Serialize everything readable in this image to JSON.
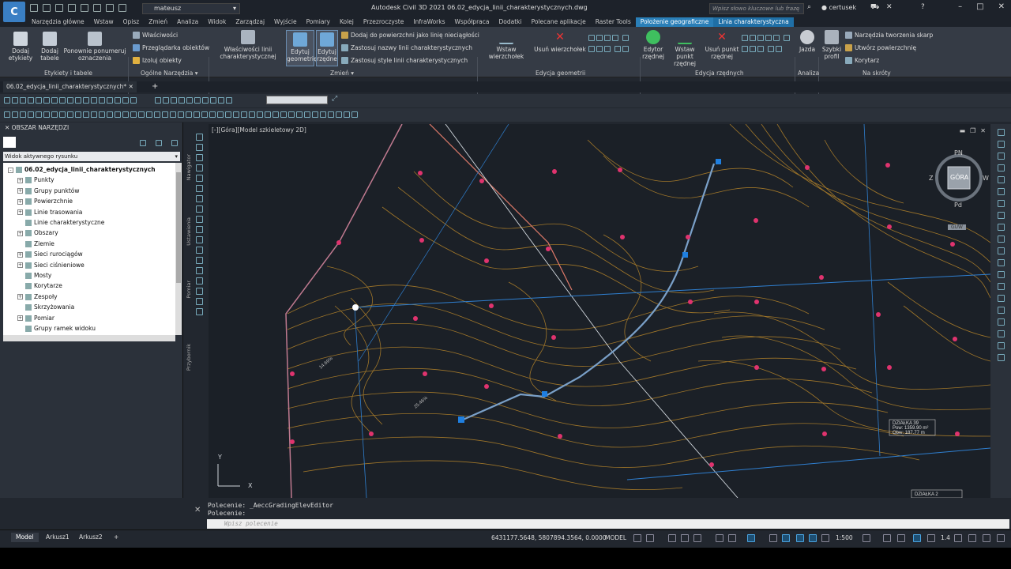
{
  "app": {
    "logo_letter": "C",
    "workspace": "mateusz",
    "window_title": "Autodesk Civil 3D 2021   06.02_edycja_linii_charakterystycznych.dwg",
    "search_placeholder": "Wpisz słowo kluczowe lub frazę",
    "user": "certusek"
  },
  "ribbon_tabs": [
    "Narzędzia główne",
    "Wstaw",
    "Opisz",
    "Zmień",
    "Analiza",
    "Widok",
    "Zarządzaj",
    "Wyjście",
    "Pomiary",
    "Kolej",
    "Przezroczyste",
    "InfraWorks",
    "Współpraca",
    "Dodatki",
    "Polecane aplikacje",
    "Raster Tools",
    "Położenie geograficzne",
    "Linia charakterystyczna"
  ],
  "ribbon": {
    "dodaj_etykiety": "Dodaj etykiety",
    "dodaj_tabele": "Dodaj tabele",
    "ponownie_ponumeruj": "Ponownie ponumeruj oznaczenia",
    "panel_etykiety": "Etykiety i tabele",
    "wlasciwosci": "Właściwości",
    "przegladarka": "Przeglądarka obiektów",
    "izoluj": "Izoluj obiekty",
    "panel_ogolne": "Ogólne Narzędzia",
    "wlasciwosci_linii": "Właściwości linii charakterystycznej",
    "edytuj_geometrie": "Edytuj geometrię",
    "edytuj_rzedne": "Edytuj rzędne",
    "dodaj_do_powierzchni": "Dodaj do powierzchni jako linię nieciągłości",
    "zastosuj_nazwy": "Zastosuj nazwy linii charakterystycznych",
    "zastosuj_style": "Zastosuj style linii charakterystycznych",
    "panel_zmien": "Zmień",
    "wstaw_wierzcholek": "Wstaw wierzchołek",
    "usun_wierzcholek": "Usuń wierzchołek",
    "panel_edycja_geometrii": "Edycja geometrii",
    "edytor_rzednej": "Edytor rzędnej",
    "wstaw_punkt_rzednej": "Wstaw punkt rzędnej",
    "usun_punkt_rzednej": "Usuń punkt rzędnej",
    "panel_edycja_rzednych": "Edycja rzędnych",
    "jazda": "Jazda",
    "panel_analiza": "Analiza",
    "szybki_profil": "Szybki profil",
    "narzedzia_skarp": "Narzędzia tworzenia skarp",
    "utworz_powierzchnie": "Utwórz powierzchnię",
    "korytarz": "Korytarz",
    "panel_na_skroty": "Na skróty"
  },
  "doc_tab": "06.02_edycja_linii_charakterystycznych*",
  "toolspace": {
    "title": "OBSZAR NARZĘDZI",
    "view_select": "Widok aktywnego rysunku",
    "side_tabs": [
      "Nawigator",
      "Ustawienia",
      "Pomiar",
      "Przybornik"
    ],
    "tree": [
      {
        "label": "06.02_edycja_linii_charakterystycznych",
        "level": 0,
        "exp": "-",
        "bold": true
      },
      {
        "label": "Punkty",
        "level": 1,
        "exp": "+"
      },
      {
        "label": "Grupy punktów",
        "level": 1,
        "exp": "+"
      },
      {
        "label": "Powierzchnie",
        "level": 1,
        "exp": "+"
      },
      {
        "label": "Linie trasowania",
        "level": 1,
        "exp": "+"
      },
      {
        "label": "Linie charakterystyczne",
        "level": 1,
        "exp": ""
      },
      {
        "label": "Obszary",
        "level": 1,
        "exp": "+"
      },
      {
        "label": "Ziemie",
        "level": 1,
        "exp": ""
      },
      {
        "label": "Sieci rurociągów",
        "level": 1,
        "exp": "+"
      },
      {
        "label": "Sieci ciśnieniowe",
        "level": 1,
        "exp": "+"
      },
      {
        "label": "Mosty",
        "level": 1,
        "exp": ""
      },
      {
        "label": "Korytarze",
        "level": 1,
        "exp": ""
      },
      {
        "label": "Zespoły",
        "level": 1,
        "exp": "+"
      },
      {
        "label": "Skrzyżowania",
        "level": 1,
        "exp": ""
      },
      {
        "label": "Pomiar",
        "level": 1,
        "exp": "+"
      },
      {
        "label": "Grupy ramek widoku",
        "level": 1,
        "exp": ""
      }
    ]
  },
  "viewport": {
    "label": "[-][Góra][Model szkieletowy 2D]",
    "cube": {
      "n": "PN",
      "s": "Pd",
      "e": "W",
      "w": "Z",
      "face": "GÓRA",
      "ucs": "GUW"
    },
    "axis_y": "Y",
    "axis_x": "X",
    "label_dzialka1": "DZIAŁKA 39",
    "label_pow1": "Pow: 1359.90 m²",
    "label_obw1": "Obw: 187.77 m",
    "label_dzialka2": "DZIAŁKA 2",
    "label_slope1": "25.46%",
    "label_slope2": "14.69%"
  },
  "command": {
    "line1": "Polecenie: _AeccGradingElevEditor",
    "line2": "Polecenie:",
    "placeholder": "Wpisz polecenie"
  },
  "status": {
    "layout_tabs": [
      "Model",
      "Arkusz1",
      "Arkusz2"
    ],
    "coords": "6431177.5648, 5807894.3564, 0.0000",
    "model": "MODEL",
    "scale": "1:500",
    "value": "1.4"
  },
  "colors": {
    "accent": "#2a7fb8",
    "contour": "#b8862a",
    "pink": "#e0336e",
    "blue_line": "#2f7fd0",
    "breakline": "#7aa0c8"
  }
}
